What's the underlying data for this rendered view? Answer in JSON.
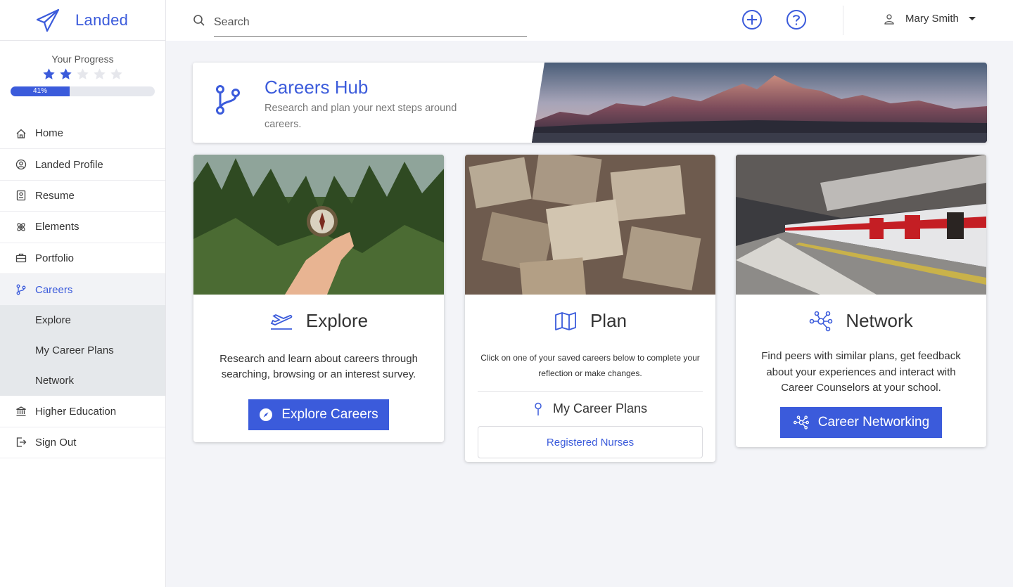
{
  "app": {
    "name": "Landed"
  },
  "progress": {
    "title": "Your Progress",
    "stars_filled": 2,
    "stars_total": 5,
    "percent": 41,
    "percent_label": "41%"
  },
  "nav": {
    "items": [
      {
        "label": "Home",
        "icon": "home-icon"
      },
      {
        "label": "Landed Profile",
        "icon": "user-circle-icon"
      },
      {
        "label": "Resume",
        "icon": "resume-icon"
      },
      {
        "label": "Elements",
        "icon": "atom-icon"
      },
      {
        "label": "Portfolio",
        "icon": "briefcase-icon"
      },
      {
        "label": "Careers",
        "icon": "branch-icon"
      },
      {
        "label": "Higher Education",
        "icon": "institution-icon"
      },
      {
        "label": "Sign Out",
        "icon": "sign-out-icon"
      }
    ],
    "careers_sub": [
      {
        "label": "Explore"
      },
      {
        "label": "My Career Plans"
      },
      {
        "label": "Network"
      }
    ]
  },
  "topbar": {
    "search_placeholder": "Search",
    "user_name": "Mary Smith"
  },
  "hub": {
    "title": "Careers Hub",
    "subtitle": "Research and plan your next steps around careers."
  },
  "cards": {
    "explore": {
      "title": "Explore",
      "text": "Research and learn about careers through searching, browsing or an interest survey.",
      "button": "Explore Careers"
    },
    "plan": {
      "title": "Plan",
      "text": "Click on one of your saved careers below to complete your reflection or make changes.",
      "section_title": "My Career Plans",
      "saved_career": "Registered Nurses"
    },
    "network": {
      "title": "Network",
      "text": "Find peers with similar plans, get feedback about your experiences and interact with Career Counselors at your school.",
      "button": "Career Networking"
    }
  },
  "colors": {
    "accent": "#3b5bdb",
    "background": "#f3f4f8"
  }
}
